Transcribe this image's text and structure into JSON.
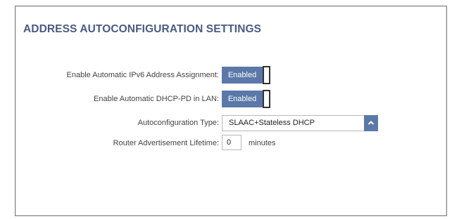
{
  "section_title": "ADDRESS AUTOCONFIGURATION SETTINGS",
  "fields": {
    "auto_ipv6": {
      "label": "Enable Automatic IPv6 Address Assignment:",
      "state": "Enabled"
    },
    "dhcp_pd": {
      "label": "Enable Automatic DHCP-PD in LAN:",
      "state": "Enabled"
    },
    "autoconf_type": {
      "label": "Autoconfiguration Type:",
      "value": "SLAAC+Stateless DHCP",
      "icon": "chevron-up-icon"
    },
    "ra_lifetime": {
      "label": "Router Advertisement Lifetime:",
      "value": "0",
      "unit": "minutes"
    }
  },
  "colors": {
    "accent": "#5b78a8",
    "title": "#4a5b80"
  }
}
